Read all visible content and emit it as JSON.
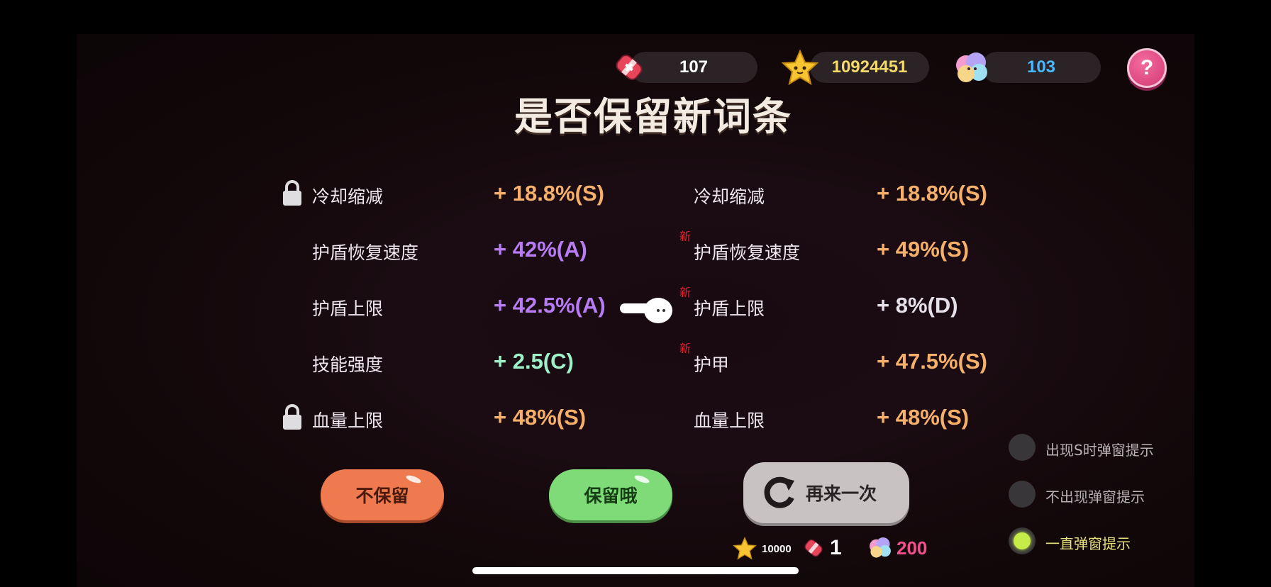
{
  "resources": {
    "tickets": "107",
    "coins": "10924451",
    "gems": "103",
    "help": "?"
  },
  "title": "是否保留新词条",
  "current": [
    {
      "name": "冷却缩减",
      "value": "+ 18.8%(S)",
      "locked": true
    },
    {
      "name": "护盾恢复速度",
      "value": "+ 42%(A)",
      "locked": false
    },
    {
      "name": "护盾上限",
      "value": "+ 42.5%(A)",
      "locked": false
    },
    {
      "name": "技能强度",
      "value": "+ 2.5(C)",
      "locked": false
    },
    {
      "name": "血量上限",
      "value": "+ 48%(S)",
      "locked": true
    }
  ],
  "new": [
    {
      "name": "冷却缩减",
      "value": "+ 18.8%(S)",
      "is_new": false
    },
    {
      "name": "护盾恢复速度",
      "value": "+ 49%(S)",
      "is_new": true
    },
    {
      "name": "护盾上限",
      "value": "+ 8%(D)",
      "is_new": true
    },
    {
      "name": "护甲",
      "value": "+ 47.5%(S)",
      "is_new": true
    },
    {
      "name": "血量上限",
      "value": "+ 48%(S)",
      "is_new": false
    }
  ],
  "new_tag": "新",
  "buttons": {
    "discard": "不保留",
    "keep": "保留哦",
    "retry": "再来一次"
  },
  "cost": {
    "coins": "10000",
    "tickets": "1",
    "gems": "200"
  },
  "options": [
    {
      "label": "出现S时弹窗提示",
      "selected": false
    },
    {
      "label": "不出现弹窗提示",
      "selected": false
    },
    {
      "label": "一直弹窗提示",
      "selected": true
    }
  ],
  "colors": {
    "grade_S": "#f7b06a",
    "grade_A": "#b77bf6",
    "grade_C": "#9ff0c9",
    "grade_D": "#e6e0ea",
    "coins_text": "#f3da6a",
    "gems_text": "#4ab8ff",
    "cost_gems": "#f2508c",
    "selected_option": "#c6ec4a"
  }
}
